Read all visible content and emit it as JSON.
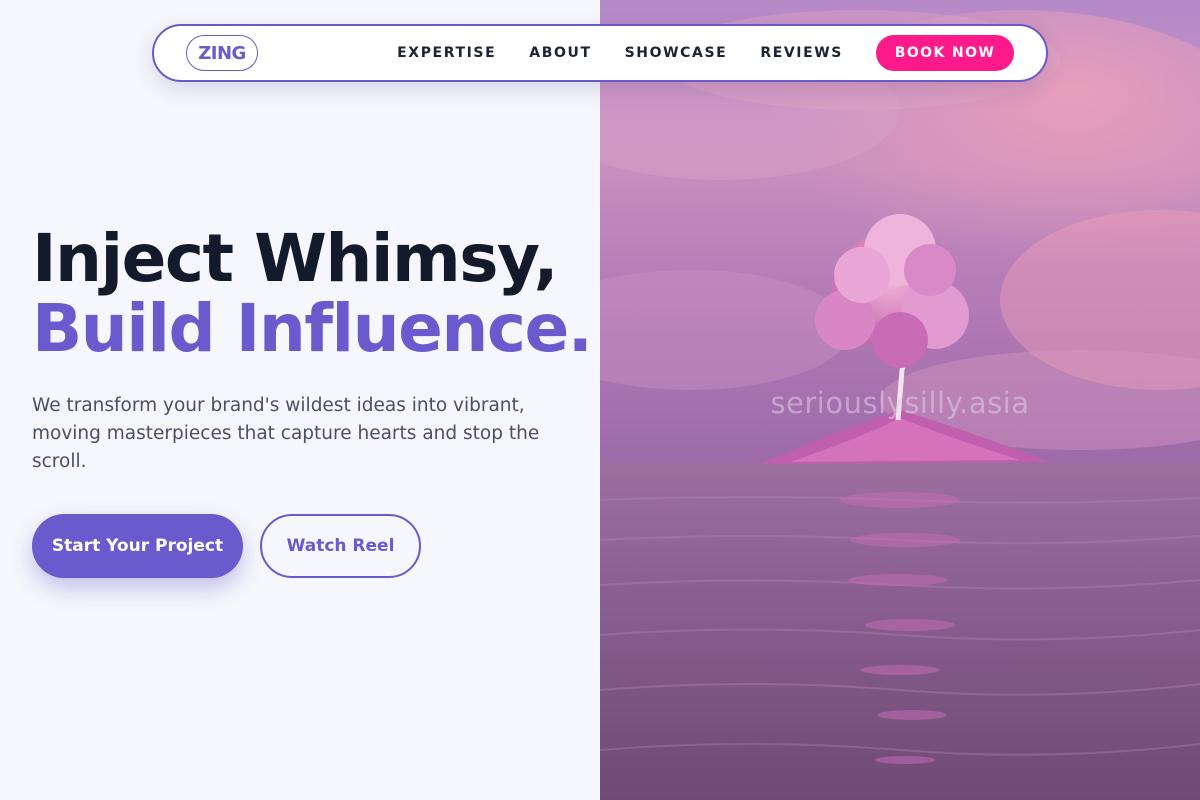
{
  "nav": {
    "logo": "ZING",
    "links": [
      {
        "label": "EXPERTISE"
      },
      {
        "label": "ABOUT"
      },
      {
        "label": "SHOWCASE"
      },
      {
        "label": "REVIEWS"
      }
    ],
    "cta_label": "BOOK NOW"
  },
  "hero": {
    "headline_line1": "Inject Whimsy,",
    "headline_line2": "Build Influence.",
    "subtext": "We transform your brand's wildest ideas into vibrant, moving masterpieces that capture hearts and stop the scroll.",
    "primary_cta": "Start Your Project",
    "secondary_cta": "Watch Reel"
  },
  "image": {
    "watermark": "seriouslysilly.asia",
    "icon": "pink-tree-island-photo"
  },
  "colors": {
    "accent": "#6a5acd",
    "cta_pink": "#ff1a8c",
    "heading_dark": "#131a2c",
    "body_text": "#4a5063",
    "background": "#f6f7fc"
  }
}
